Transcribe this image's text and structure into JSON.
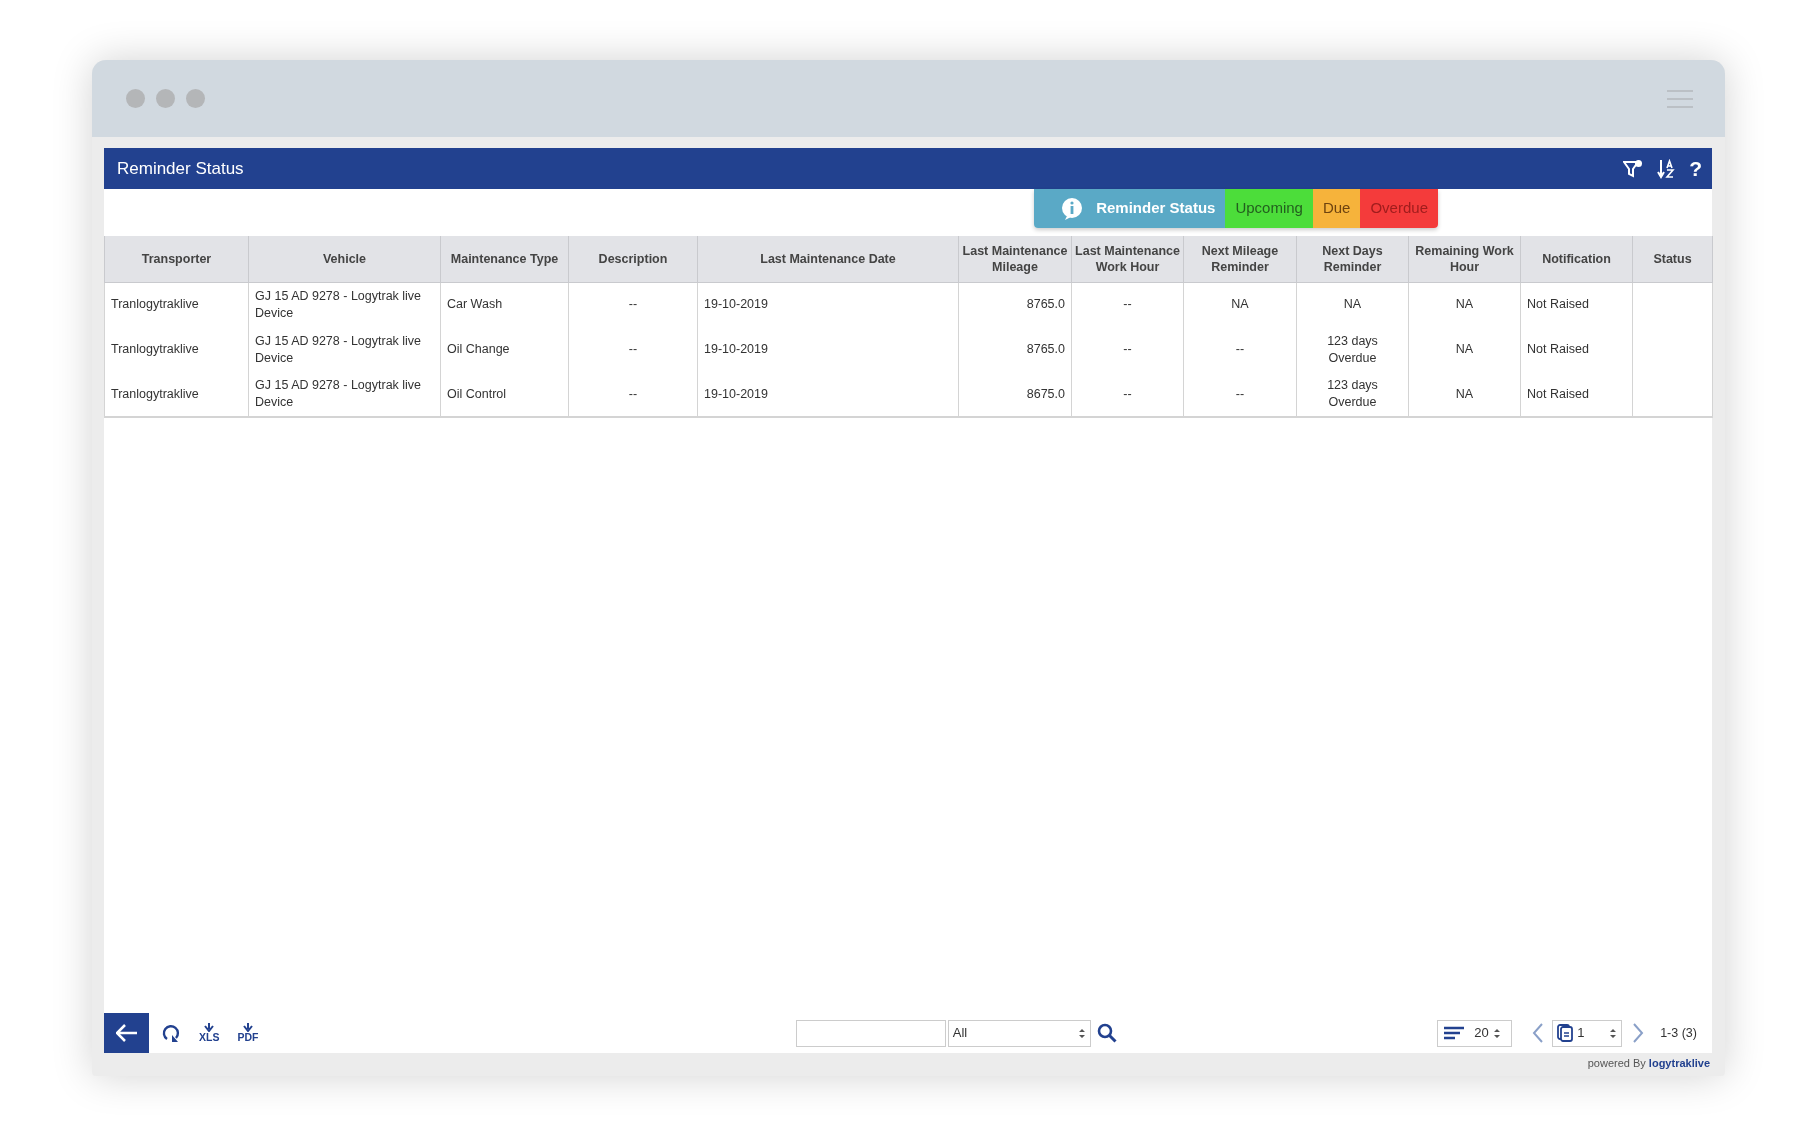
{
  "panel": {
    "title": "Reminder Status"
  },
  "header_actions": [
    {
      "kind": "filter"
    },
    {
      "kind": "sort"
    },
    {
      "kind": "help",
      "label": "?"
    }
  ],
  "legend": [
    {
      "kind": "info",
      "label": "Reminder Status",
      "color": "#5aa9c6"
    },
    {
      "kind": "swatch",
      "label": "Upcoming",
      "color": "#4cdd3a"
    },
    {
      "kind": "swatch",
      "label": "Due",
      "color": "#f6b33b"
    },
    {
      "kind": "swatch",
      "label": "Overdue",
      "color": "#f43b3b"
    }
  ],
  "table": {
    "columns": [
      "Transporter",
      "Vehicle",
      "Maintenance Type",
      "Description",
      "Last Maintenance Date",
      "Last Maintenance Mileage",
      "Last Maintenance Work Hour",
      "Next Mileage Reminder",
      "Next Days Reminder",
      "Remaining Work Hour",
      "Notification",
      "Status"
    ],
    "rows": [
      [
        "Tranlogytraklive",
        "GJ 15 AD 9278 - Logytrak live Device",
        "Car Wash",
        "--",
        "19-10-2019",
        "8765.0",
        "--",
        "NA",
        "NA",
        "NA",
        "Not Raised"
      ],
      [
        "Tranlogytraklive",
        "GJ 15 AD 9278 - Logytrak live Device",
        "Oil Change",
        "--",
        "19-10-2019",
        "8765.0",
        "--",
        "--",
        "123 days Overdue",
        "NA",
        "Not Raised"
      ],
      [
        "Tranlogytraklive",
        "GJ 15 AD 9278 - Logytrak live Device",
        "Oil Control",
        "--",
        "19-10-2019",
        "8675.0",
        "--",
        "--",
        "123 days Overdue",
        "NA",
        "Not Raised"
      ]
    ]
  },
  "footer": {
    "buttons": [
      {
        "kind": "back"
      },
      {
        "kind": "refresh"
      },
      {
        "kind": "download",
        "label": "XLS"
      },
      {
        "kind": "download",
        "label": "PDF"
      }
    ],
    "search": {
      "filter": "All"
    },
    "page_size": "20",
    "page": "1",
    "range": "1-3 (3)"
  },
  "powered_by": {
    "text": "powered By",
    "brand": "logytraklive"
  }
}
